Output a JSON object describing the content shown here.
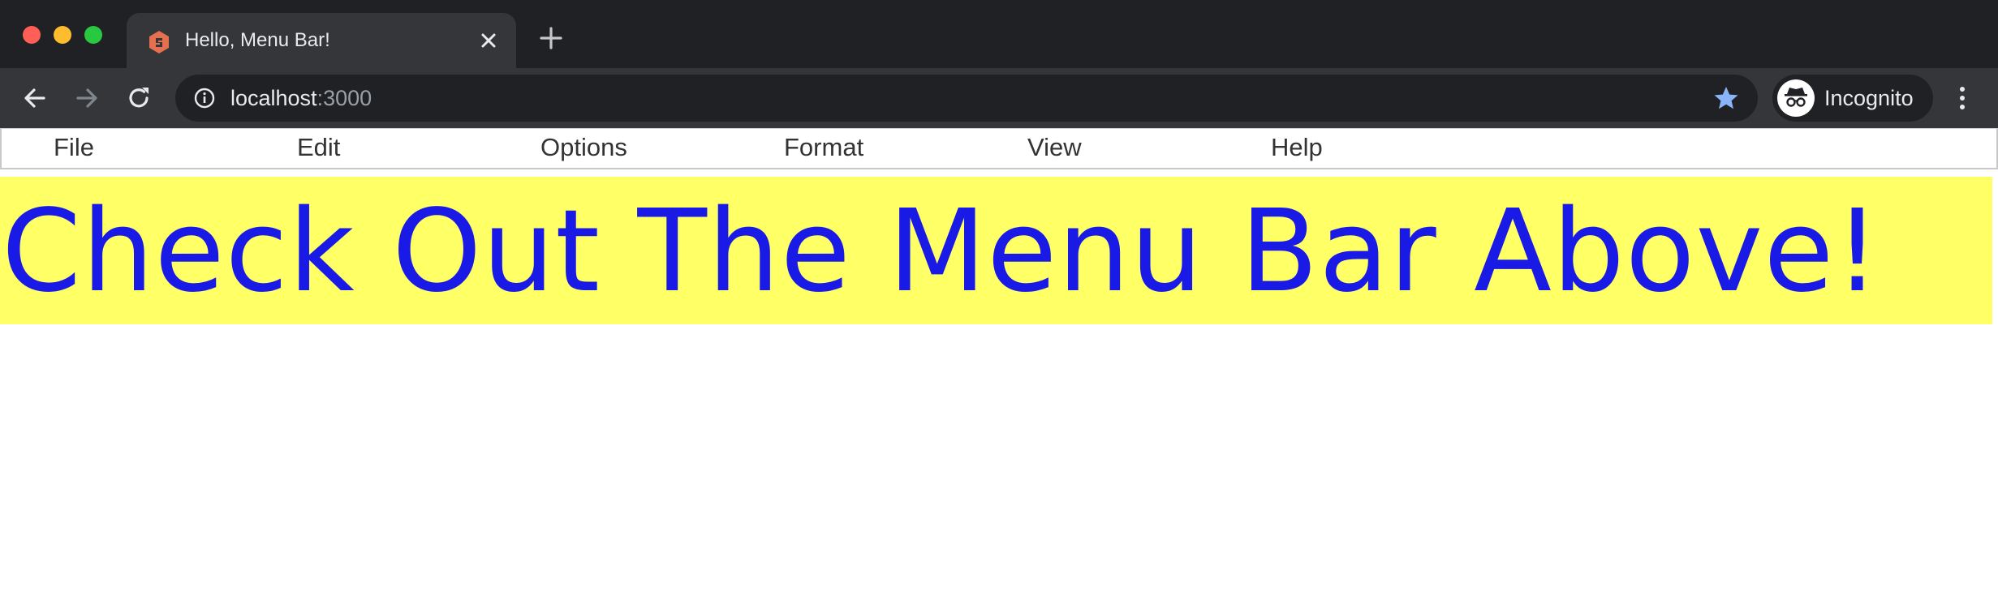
{
  "browser": {
    "tab": {
      "title": "Hello, Menu Bar!",
      "favicon": "brand-hexagon-icon"
    },
    "address": {
      "host": "localhost",
      "port": ":3000"
    },
    "profile": {
      "label": "Incognito"
    },
    "colors": {
      "chrome_dark": "#202124",
      "chrome_mid": "#35363a",
      "star": "#8ab4f8"
    }
  },
  "menubar": {
    "items": [
      {
        "label": "File"
      },
      {
        "label": "Edit"
      },
      {
        "label": "Options"
      },
      {
        "label": "Format"
      },
      {
        "label": "View"
      },
      {
        "label": "Help"
      }
    ]
  },
  "hero": {
    "text": "Check Out The Menu Bar Above!",
    "text_color": "#1a1ae6",
    "background": "#ffff66"
  }
}
